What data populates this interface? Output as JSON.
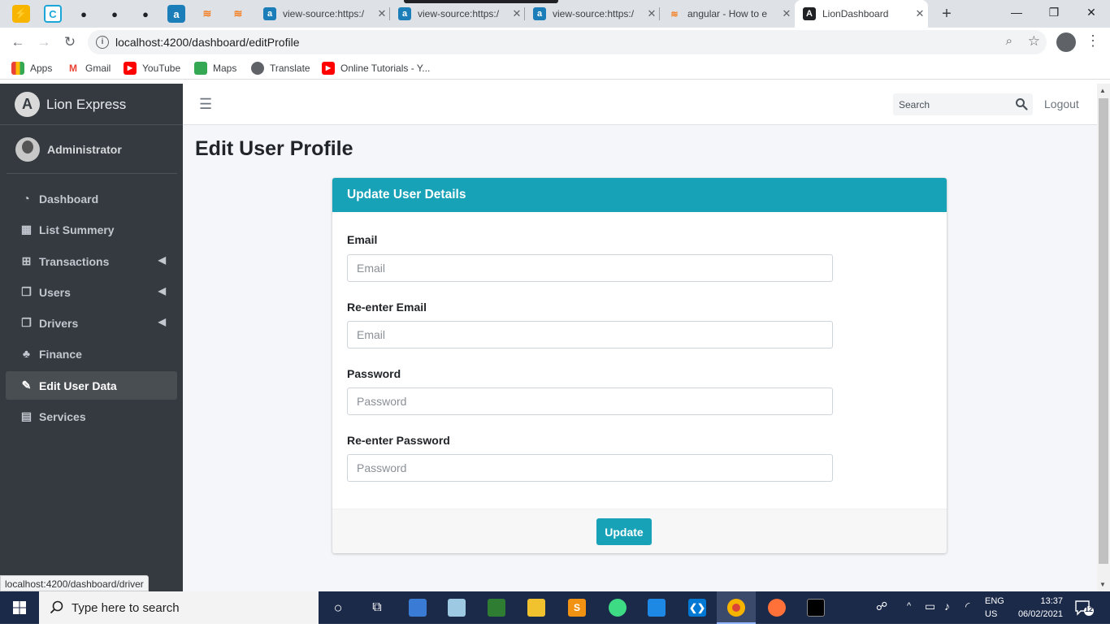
{
  "browser": {
    "tabs": [
      {
        "title": "view-source:https:/",
        "icon": "app-a-icon"
      },
      {
        "title": "view-source:https:/",
        "icon": "app-a-icon"
      },
      {
        "title": "view-source:https:/",
        "icon": "app-a-icon"
      },
      {
        "title": "angular - How to e",
        "icon": "stackoverflow-icon"
      },
      {
        "title": "LionDashboard",
        "icon": "angular-icon",
        "active": true
      }
    ],
    "close_glyph": "✕",
    "new_tab_glyph": "+",
    "url": "localhost:4200/dashboard/editProfile",
    "bookmarks": [
      "Apps",
      "Gmail",
      "YouTube",
      "Maps",
      "Translate",
      "Online Tutorials - Y..."
    ]
  },
  "app": {
    "brand": "Lion Express",
    "brand_logo_letter": "A",
    "user": "Administrator",
    "nav": [
      {
        "label": "Dashboard",
        "icon": "tachometer-icon"
      },
      {
        "label": "List Summery",
        "icon": "th-icon"
      },
      {
        "label": "Transactions",
        "icon": "table-icon",
        "has_children": true
      },
      {
        "label": "Users",
        "icon": "copy-icon",
        "has_children": true
      },
      {
        "label": "Drivers",
        "icon": "copy-icon",
        "has_children": true
      },
      {
        "label": "Finance",
        "icon": "tree-icon"
      },
      {
        "label": "Edit User Data",
        "icon": "edit-icon",
        "active": true
      },
      {
        "label": "Services",
        "icon": "calendar-icon"
      }
    ],
    "header": {
      "search_placeholder": "Search",
      "logout": "Logout"
    },
    "page_title": "Edit User Profile",
    "card": {
      "title": "Update User Details",
      "fields": [
        {
          "label": "Email",
          "placeholder": "Email"
        },
        {
          "label": "Re-enter Email",
          "placeholder": "Email"
        },
        {
          "label": "Password",
          "placeholder": "Password"
        },
        {
          "label": "Re-enter Password",
          "placeholder": "Password"
        }
      ],
      "submit": "Update"
    },
    "status_url": "localhost:4200/dashboard/driver"
  },
  "taskbar": {
    "search_text": "Type here to search",
    "lang_top": "ENG",
    "lang_bottom": "US",
    "time": "13:37",
    "date": "06/02/2021",
    "notifications": "12"
  },
  "colors": {
    "accent": "#17a2b8",
    "sidebar_bg": "#343a40",
    "content_bg": "#f4f6f9",
    "taskbar_bg": "#1c2a4a"
  }
}
